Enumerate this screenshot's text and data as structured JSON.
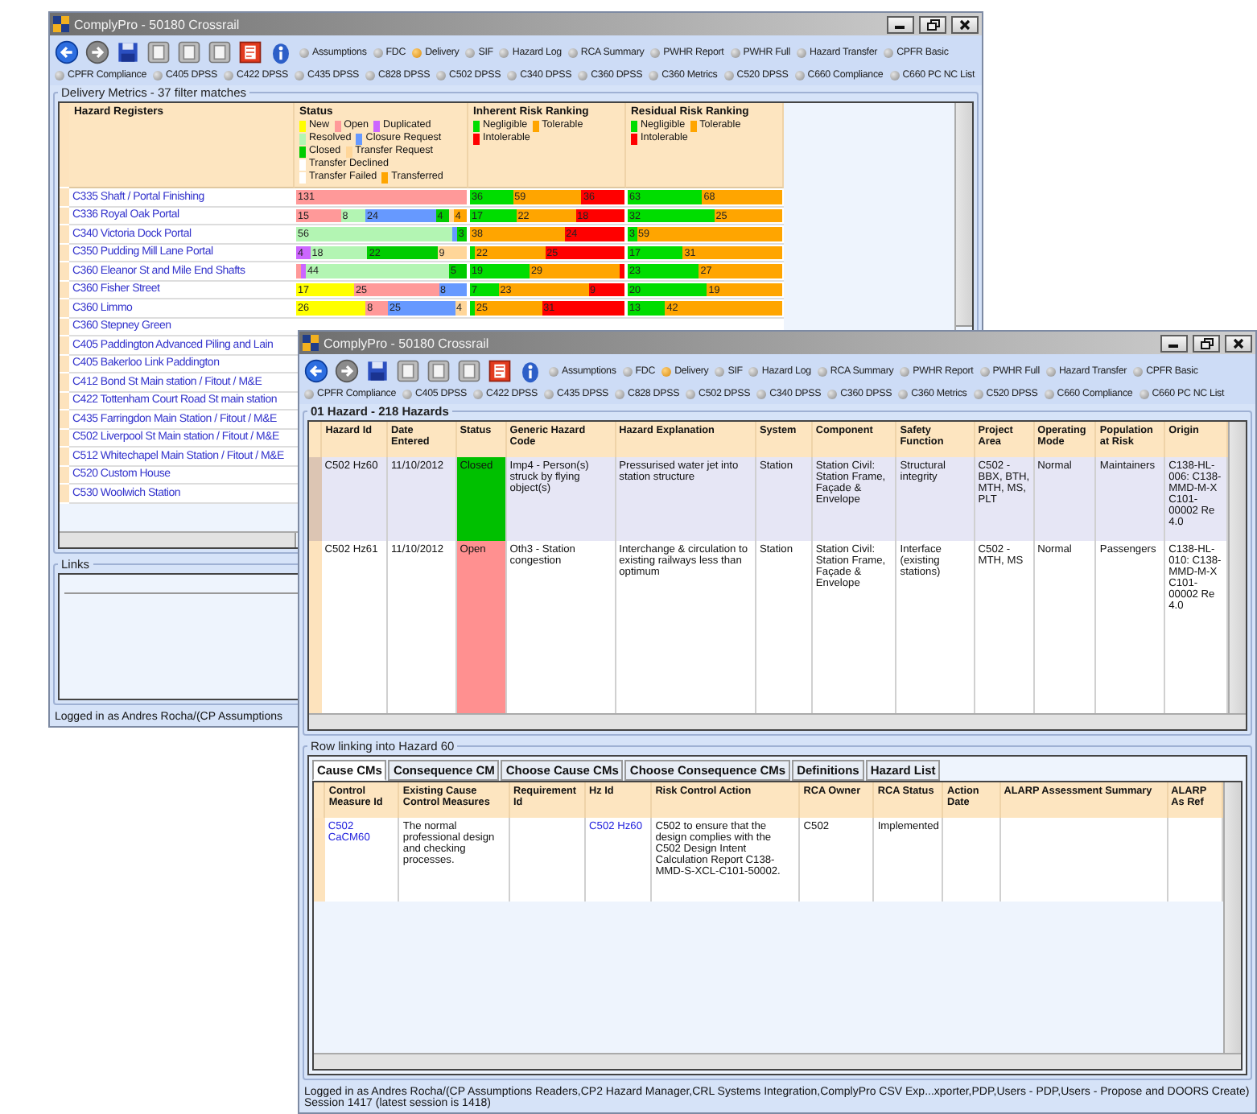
{
  "windows": [
    {
      "title": "ComplyPro - 50180 Crossrail",
      "reports": [
        {
          "label": "Assumptions",
          "selected": false
        },
        {
          "label": "FDC",
          "selected": false
        },
        {
          "label": "Delivery",
          "selected": true
        },
        {
          "label": "SIF",
          "selected": false
        },
        {
          "label": "Hazard Log",
          "selected": false
        },
        {
          "label": "RCA Summary",
          "selected": false
        },
        {
          "label": "PWHR Report",
          "selected": false
        },
        {
          "label": "PWHR Full",
          "selected": false
        },
        {
          "label": "Hazard Transfer",
          "selected": false
        },
        {
          "label": "CPFR Basic",
          "selected": false
        },
        {
          "label": "CPFR Compliance",
          "selected": false
        },
        {
          "label": "C405 DPSS",
          "selected": false
        },
        {
          "label": "C422 DPSS",
          "selected": false
        },
        {
          "label": "C435 DPSS",
          "selected": false
        },
        {
          "label": "C828 DPSS",
          "selected": false
        },
        {
          "label": "C502 DPSS",
          "selected": false
        },
        {
          "label": "C340 DPSS",
          "selected": false
        },
        {
          "label": "C360 DPSS",
          "selected": false
        },
        {
          "label": "C360 Metrics",
          "selected": false
        },
        {
          "label": "C520 DPSS",
          "selected": false
        },
        {
          "label": "C660 Compliance",
          "selected": false
        },
        {
          "label": "C660 PC NC List",
          "selected": false
        }
      ],
      "metrics": {
        "title": "Delivery Metrics - 37 filter matches",
        "columns": [
          {
            "title": "Hazard Registers"
          },
          {
            "title": "Status",
            "legend": [
              {
                "label": "New",
                "color": "#ffff00"
              },
              {
                "label": "Open",
                "color": "#ff9999"
              },
              {
                "label": "Duplicated",
                "color": "#cc66ff"
              },
              {
                "label": "Resolved",
                "color": "#b3f5b3"
              },
              {
                "label": "Closure Request",
                "color": "#6699ff"
              },
              {
                "label": "Closed",
                "color": "#00cc00"
              },
              {
                "label": "Transfer Request",
                "color": "#ffd699"
              },
              {
                "label": "Transfer Declined",
                "color": "#ffffff"
              },
              {
                "label": "Transfer Failed",
                "color": "#ffffff"
              },
              {
                "label": "Transferred",
                "color": "#ffa500"
              }
            ]
          },
          {
            "title": "Inherent Risk Ranking",
            "legend": [
              {
                "label": "Negligible",
                "color": "#00dd00"
              },
              {
                "label": "Tolerable",
                "color": "#ffa500"
              },
              {
                "label": "Intolerable",
                "color": "#ff0000"
              }
            ]
          },
          {
            "title": "Residual Risk Ranking",
            "legend": [
              {
                "label": "Negligible",
                "color": "#00dd00"
              },
              {
                "label": "Tolerable",
                "color": "#ffa500"
              },
              {
                "label": "Intolerable",
                "color": "#ff0000"
              }
            ]
          }
        ],
        "rows": [
          {
            "name": "C335 Shaft / Portal Finishing",
            "bars": [
              [
                {
                  "color": "#ff9999",
                  "label": "131"
                }
              ],
              [
                {
                  "color": "#00dd00",
                  "label": "36"
                },
                {
                  "color": "#ffa500",
                  "label": "59"
                },
                {
                  "color": "#ff0000",
                  "label": "36"
                }
              ],
              [
                {
                  "color": "#00dd00",
                  "label": "63"
                },
                {
                  "color": "#ffa500",
                  "label": "68"
                }
              ]
            ]
          },
          {
            "name": "C336 Royal Oak Portal",
            "bars": [
              [
                {
                  "color": "#ff9999",
                  "label": "15"
                },
                {
                  "color": "#b3f5b3",
                  "label": "8"
                },
                {
                  "color": "#6699ff",
                  "label": "24"
                },
                {
                  "color": "#00cc00",
                  "label": "4"
                },
                {
                  "color": "#ffd699"
                },
                {
                  "color": "#ffa500",
                  "label": "4"
                }
              ],
              [
                {
                  "color": "#00dd00",
                  "label": "17"
                },
                {
                  "color": "#ffa500",
                  "label": "22"
                },
                {
                  "color": "#ff0000",
                  "label": "18"
                }
              ],
              [
                {
                  "color": "#00dd00",
                  "label": "32"
                },
                {
                  "color": "#ffa500",
                  "label": "25"
                }
              ]
            ]
          },
          {
            "name": "C340 Victoria Dock Portal",
            "bars": [
              [
                {
                  "color": "#b3f5b3",
                  "label": "56"
                },
                {
                  "color": "#6699ff"
                },
                {
                  "color": "#00cc00",
                  "label": "3"
                }
              ],
              [
                {
                  "color": "#ffa500",
                  "label": "38"
                },
                {
                  "color": "#ff0000",
                  "label": "24"
                }
              ],
              [
                {
                  "color": "#00dd00",
                  "label": "3"
                },
                {
                  "color": "#ffa500",
                  "label": "59"
                }
              ]
            ]
          },
          {
            "name": "C350 Pudding Mill Lane Portal",
            "bars": [
              [
                {
                  "color": "#cc66ff",
                  "label": "4"
                },
                {
                  "color": "#b3f5b3",
                  "label": "18"
                },
                {
                  "color": "#00cc00",
                  "label": "22"
                },
                {
                  "color": "#ffd699",
                  "label": "9"
                }
              ],
              [
                {
                  "color": "#00dd00"
                },
                {
                  "color": "#ffa500",
                  "label": "22"
                },
                {
                  "color": "#ff0000",
                  "label": "25"
                }
              ],
              [
                {
                  "color": "#00dd00",
                  "label": "17"
                },
                {
                  "color": "#ffa500",
                  "label": "31"
                }
              ]
            ]
          },
          {
            "name": "C360 Eleanor St and Mile End Shafts",
            "bars": [
              [
                {
                  "color": "#ff9999"
                },
                {
                  "color": "#cc66ff"
                },
                {
                  "color": "#b3f5b3",
                  "label": "44"
                },
                {
                  "color": "#00cc00",
                  "label": "5"
                }
              ],
              [
                {
                  "color": "#00dd00",
                  "label": "19"
                },
                {
                  "color": "#ffa500",
                  "label": "29"
                },
                {
                  "color": "#ff0000"
                }
              ],
              [
                {
                  "color": "#00dd00",
                  "label": "23"
                },
                {
                  "color": "#ffa500",
                  "label": "27"
                }
              ]
            ]
          },
          {
            "name": "C360 Fisher Street",
            "bars": [
              [
                {
                  "color": "#ffff00",
                  "label": "17"
                },
                {
                  "color": "#ff9999",
                  "label": "25"
                },
                {
                  "color": "#6699ff",
                  "label": "8"
                }
              ],
              [
                {
                  "color": "#00dd00",
                  "label": "7"
                },
                {
                  "color": "#ffa500",
                  "label": "23"
                },
                {
                  "color": "#ff0000",
                  "label": "9"
                }
              ],
              [
                {
                  "color": "#00dd00",
                  "label": "20"
                },
                {
                  "color": "#ffa500",
                  "label": "19"
                }
              ]
            ]
          },
          {
            "name": "C360 Limmo",
            "bars": [
              [
                {
                  "color": "#ffff00",
                  "label": "26"
                },
                {
                  "color": "#ff9999",
                  "label": "8"
                },
                {
                  "color": "#6699ff",
                  "label": "25"
                },
                {
                  "color": "#ffd699",
                  "label": "4"
                }
              ],
              [
                {
                  "color": "#00dd00"
                },
                {
                  "color": "#ffa500",
                  "label": "25"
                },
                {
                  "color": "#ff0000",
                  "label": "31"
                }
              ],
              [
                {
                  "color": "#00dd00",
                  "label": "13"
                },
                {
                  "color": "#ffa500",
                  "label": "42"
                }
              ]
            ]
          },
          {
            "name": "C360 Stepney Green"
          },
          {
            "name": "C405 Paddington Advanced Piling and Lain"
          },
          {
            "name": "C405 Bakerloo Link Paddington"
          },
          {
            "name": "C412 Bond St Main station / Fitout / M&E"
          },
          {
            "name": "C422 Tottenham Court Road St main station"
          },
          {
            "name": "C435 Farringdon Main Station / Fitout / M&E"
          },
          {
            "name": "C502 Liverpool St Main station / Fitout / M&E"
          },
          {
            "name": "C512 Whitechapel Main Station / Fitout / M&E"
          },
          {
            "name": "C520 Custom House"
          },
          {
            "name": "C530 Woolwich Station"
          }
        ]
      },
      "links": {
        "title": "Links"
      },
      "status_bar": {
        "user": "Logged in as Andres Rocha/(CP Assumptions"
      }
    },
    {
      "title": "ComplyPro - 50180 Crossrail",
      "reports": [
        {
          "label": "Assumptions",
          "selected": false
        },
        {
          "label": "FDC",
          "selected": false
        },
        {
          "label": "Delivery",
          "selected": true
        },
        {
          "label": "SIF",
          "selected": false
        },
        {
          "label": "Hazard Log",
          "selected": false
        },
        {
          "label": "RCA Summary",
          "selected": false
        },
        {
          "label": "PWHR Report",
          "selected": false
        },
        {
          "label": "PWHR Full",
          "selected": false
        },
        {
          "label": "Hazard Transfer",
          "selected": false
        },
        {
          "label": "CPFR Basic",
          "selected": false
        },
        {
          "label": "CPFR Compliance",
          "selected": false
        },
        {
          "label": "C405 DPSS",
          "selected": false
        },
        {
          "label": "C422 DPSS",
          "selected": false
        },
        {
          "label": "C435 DPSS",
          "selected": false
        },
        {
          "label": "C828 DPSS",
          "selected": false
        },
        {
          "label": "C502 DPSS",
          "selected": false
        },
        {
          "label": "C340 DPSS",
          "selected": false
        },
        {
          "label": "C360 DPSS",
          "selected": false
        },
        {
          "label": "C360 Metrics",
          "selected": false
        },
        {
          "label": "C520 DPSS",
          "selected": false
        },
        {
          "label": "C660 Compliance",
          "selected": false
        },
        {
          "label": "C660 PC NC List",
          "selected": false
        }
      ],
      "hazards": {
        "title": "01 Hazard - 218 Hazards",
        "columns": [
          "Hazard Id",
          "Date Entered",
          "Status",
          "Generic Hazard Code",
          "Hazard Explanation",
          "System",
          "Component",
          "Safety Function",
          "Project Area",
          "Operating Mode",
          "Population at Risk",
          "Origin"
        ],
        "rows": [
          {
            "selected": true,
            "cells": [
              {
                "text": "C502 Hz60"
              },
              {
                "text": "11/10/2012"
              },
              {
                "text": "Closed",
                "color": "#00c000"
              },
              {
                "text": "Imp4  -  Person(s) struck by flying object(s)"
              },
              {
                "text": "Pressurised water jet into station structure"
              },
              {
                "text": "Station"
              },
              {
                "text": "Station Civil: Station Frame, Façade & Envelope"
              },
              {
                "text": "Structural integrity"
              },
              {
                "text": "C502 - BBX, BTH, MTH, MS, PLT"
              },
              {
                "text": "Normal"
              },
              {
                "text": "Maintainers"
              },
              {
                "text": "C138-HL-006: C138-MMD-M-X C101-00002 Re 4.0"
              }
            ]
          },
          {
            "selected": false,
            "cells": [
              {
                "text": "C502 Hz61"
              },
              {
                "text": "11/10/2012"
              },
              {
                "text": "Open",
                "color": "#ff9090"
              },
              {
                "text": "Oth3  -  Station congestion"
              },
              {
                "text": "Interchange & circulation to existing railways less than optimum"
              },
              {
                "text": "Station"
              },
              {
                "text": "Station Civil: Station Frame, Façade & Envelope"
              },
              {
                "text": "Interface (existing stations)"
              },
              {
                "text": "C502 - MTH, MS"
              },
              {
                "text": "Normal"
              },
              {
                "text": "Passengers"
              },
              {
                "text": "C138-HL-010: C138-MMD-M-X C101-00002 Re 4.0"
              }
            ]
          }
        ]
      },
      "linked": {
        "title": "Row linking into Hazard 60",
        "tabs": [
          {
            "label": "Cause CMs",
            "selected": true
          },
          {
            "label": "Consequence CM",
            "selected": false
          },
          {
            "label": "Choose Cause CMs",
            "selected": false
          },
          {
            "label": "Choose Consequence CMs",
            "selected": false
          },
          {
            "label": "Definitions",
            "selected": false
          },
          {
            "label": "Hazard List",
            "selected": false
          }
        ],
        "columns": [
          "Control Measure Id",
          "Existing Cause Control Measures",
          "Requirement Id",
          "Hz Id",
          "Risk Control Action",
          "RCA Owner",
          "RCA Status",
          "Action Date",
          "ALARP Assessment Summary",
          "ALARP As Ref"
        ],
        "rows": [
          {
            "selected": false,
            "cells": [
              {
                "text": "C502 CaCM60",
                "link": true
              },
              {
                "text": "The normal professional design and checking processes."
              },
              null,
              {
                "text": "C502 Hz60",
                "link": true
              },
              {
                "text": "C502 to ensure that the design complies with the C502 Design Intent Calculation Report C138-MMD-S-XCL-C101-50002."
              },
              {
                "text": "C502"
              },
              {
                "text": "Implemented"
              },
              null,
              null,
              null
            ]
          }
        ]
      },
      "status_bar": {
        "user": "Logged in as Andres Rocha/(CP Assumptions Readers,CP2 Hazard Manager,CRL Systems Integration,ComplyPro CSV Exp...xporter,PDP,Users - PDP,Users - Propose and DOORS Create)",
        "session": "Session 1417 (latest session is 1418)"
      }
    }
  ]
}
